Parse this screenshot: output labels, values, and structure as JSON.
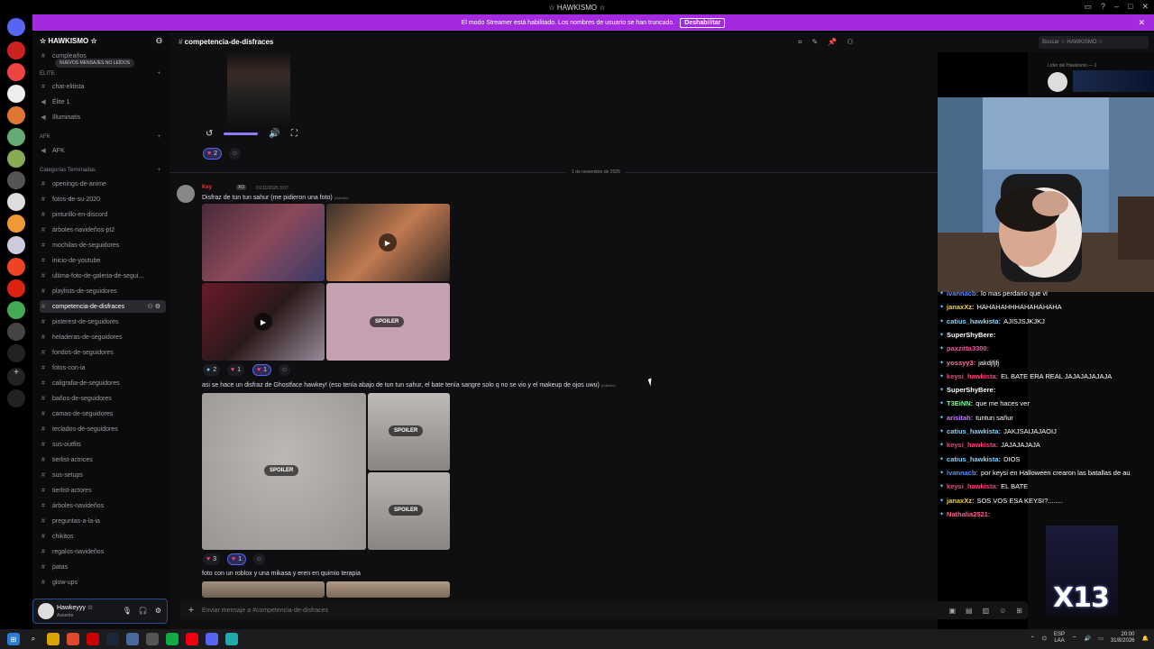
{
  "window": {
    "title": "☆ HAWKISMO ☆"
  },
  "streamer": {
    "message": "El modo Streamer está habilitado. Los nombres de usuario se han truncado.",
    "disable_label": "Deshabilitar"
  },
  "guild": {
    "name": "☆ HAWKISMO ☆"
  },
  "sidebar": {
    "new_messages": "NUEVOS MENSAJES NO LEÍDOS",
    "cut_channel": "cumpleaños",
    "cat_elite": "ÉLITE",
    "elite_channels": [
      "chat-elitista",
      "Élite 1",
      "Illuminatis"
    ],
    "cat_afk": "AFK",
    "afk_channels": [
      "AFK"
    ],
    "cat_done": "Categorías Terminadas",
    "done_channels": [
      "openings-de-anime",
      "fotos-de-su-2020",
      "pinturillo-en-discord",
      "árboles-navideños-pt2",
      "mochilas-de-seguidores",
      "inicio-de-youtube",
      "ultima-foto-de-galeria-de-segui...",
      "playlists-de-seguidores",
      "competencia-de-disfraces",
      "pinterest-de-seguidores",
      "heladeras-de-seguidores",
      "fondos-de-seguidores",
      "fotos-con-ia",
      "caligrafia-de-seguidores",
      "baños-de-seguidores",
      "camas-de-seguidores",
      "teclados-de-seguidores",
      "sus-outfits",
      "tierlist-actrices",
      "sus-setups",
      "tierlist-actores",
      "árboles-navideños",
      "preguntas-a-la-ia",
      "chikitos",
      "regalos-navideños",
      "patas",
      "glow-ups"
    ]
  },
  "user": {
    "name": "Hawkeyyy ☆",
    "status": "Ausente"
  },
  "channel": {
    "name": "competencia-de-disfraces"
  },
  "search": {
    "placeholder": "Buscar ☆ HAWKISMO ☆"
  },
  "messages": {
    "date_divider": "1 de noviembre de 2025",
    "author": "Key",
    "badge": "XO",
    "time": "01/11/2025 3:07",
    "text1": "Disfraz de tun tun sahur (me pidieron una foto)",
    "edited": "(editado)",
    "text2": "asi se hace un disfraz de Ghostface hawkey! (eso tenía abajo de tun tun sahur, el bate tenía sangre solo q no se vio y el makeup de ojos uwu)",
    "text3": "foto con un roblox y una mikasa y eren en quimio terapia",
    "spoiler": "SPOILER",
    "reactions_prev": [
      "2"
    ],
    "reactions1": [
      "2",
      "1",
      "1"
    ],
    "reactions2": [
      "3",
      "1"
    ]
  },
  "composer": {
    "placeholder": "Enviar mensaje a #competencia-de-disfraces"
  },
  "members": {
    "role": "Líder del Hawkismo — 1"
  },
  "chat": [
    {
      "user": "ivannacb",
      "color": "#5b8cff",
      "text": "lo mas perdario que vi"
    },
    {
      "user": "janaxXz",
      "color": "#f4d03f",
      "text": "HAHAHAHHHAHAHAHAHA"
    },
    {
      "user": "catius_hawkista",
      "color": "#7fd6ff",
      "text": "AJISJSJKJKJ"
    },
    {
      "user": "SuperShyBere",
      "color": "#ffffff",
      "text": ""
    },
    {
      "user": "paxzitta3300",
      "color": "#ff4fa0",
      "text": ""
    },
    {
      "user": "yossyy3",
      "color": "#ff6fa0",
      "text": "jakdjfjfj"
    },
    {
      "user": "keysi_hawkista",
      "color": "#ff3f7f",
      "text": "EL BATE ERA REAL JAJAJAJAJAJA"
    },
    {
      "user": "SuperShyBere",
      "color": "#ffffff",
      "text": ""
    },
    {
      "user": "T3EiNN",
      "color": "#7cff9a",
      "text": "que me haces ver"
    },
    {
      "user": "arisitah",
      "color": "#c77dff",
      "text": "tuntun sañur"
    },
    {
      "user": "catius_hawkista",
      "color": "#7fd6ff",
      "text": "JAKJSAIJAJAOIJ"
    },
    {
      "user": "keysi_hawkista",
      "color": "#ff3f7f",
      "text": "JAJAJAJAJA"
    },
    {
      "user": "catius_hawkista",
      "color": "#7fd6ff",
      "text": "DIOS"
    },
    {
      "user": "ivannacb",
      "color": "#5b8cff",
      "text": "por keysi en Halloween crearon las batallas de au"
    },
    {
      "user": "keysi_hawkista",
      "color": "#ff3f7f",
      "text": "EL BATE"
    },
    {
      "user": "janaxXz",
      "color": "#f4d03f",
      "text": "SOS VOS ESA KEYSI?........"
    },
    {
      "user": "Nathalia2521",
      "color": "#ff5f8f",
      "text": ""
    }
  ],
  "overlay": {
    "x13": "X13"
  },
  "taskbar": {
    "lang": "ESP",
    "lang2": "LAA",
    "time": "20:00",
    "date": "31/8/2026"
  }
}
